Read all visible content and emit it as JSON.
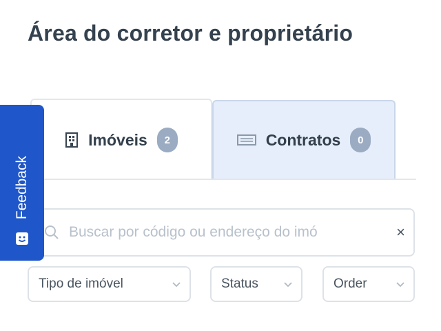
{
  "page": {
    "title": "Área do corretor e proprietário"
  },
  "tabs": [
    {
      "label": "Imóveis",
      "count": "2",
      "icon": "building-icon",
      "active": true
    },
    {
      "label": "Contratos",
      "count": "0",
      "icon": "document-icon",
      "active": false
    }
  ],
  "search": {
    "placeholder": "Buscar por código ou endereço do imó",
    "value": "",
    "clear": "×"
  },
  "filters": [
    {
      "label": "Tipo de imóvel"
    },
    {
      "label": "Status"
    },
    {
      "label": "Order"
    }
  ],
  "feedback": {
    "label": "Feedback",
    "icon": "smile-icon",
    "color": "#1f56c9"
  }
}
